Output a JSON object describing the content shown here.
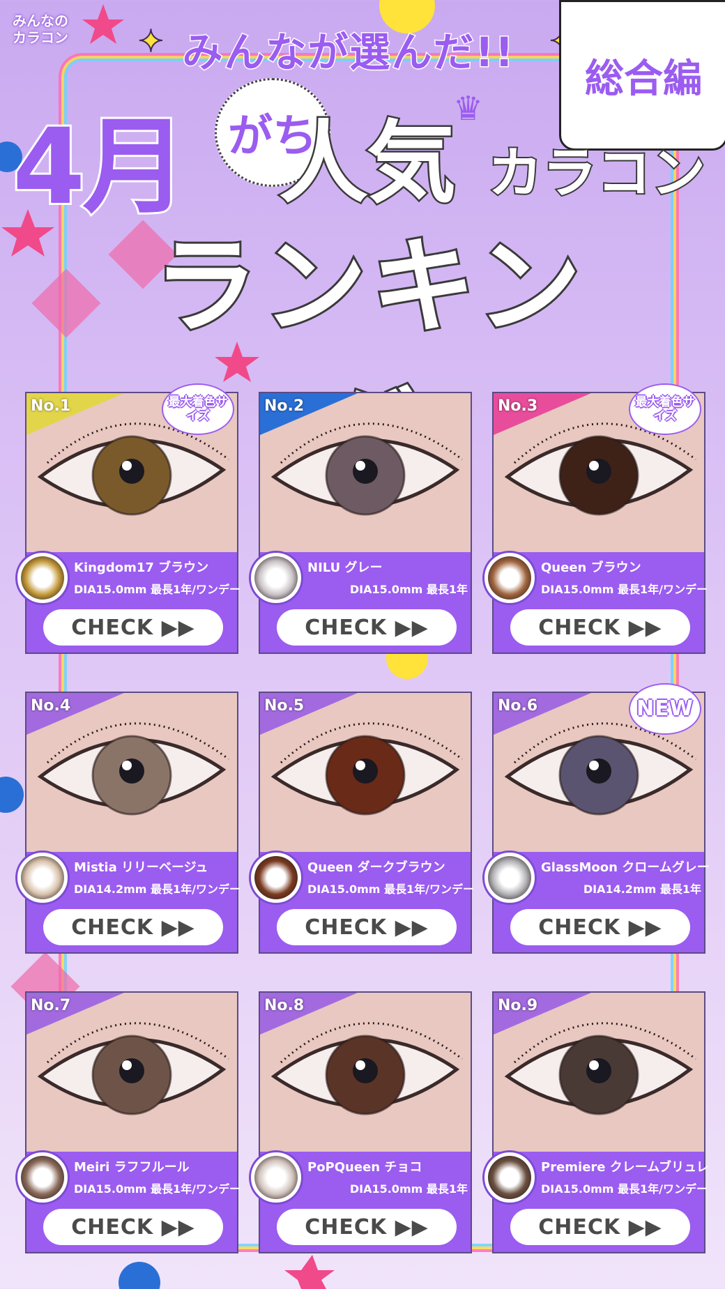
{
  "header": {
    "logo_line1": "みんなの",
    "logo_line2": "カラコン",
    "subtitle": "みんなが選んだ!!",
    "edition": "総合編",
    "month": "4月",
    "gachi": "がち",
    "popular": "人気",
    "karacon": "カラコン",
    "ranking": "ランキング",
    "sparkle_icon": "✦"
  },
  "colors": {
    "purple": "#9b5cf0",
    "rank1_tab": "#e3d54a",
    "rank2_tab": "#2a6fd6",
    "rank3_tab": "#e84d9c",
    "rank_other_tab": "#a36ae0"
  },
  "check_label": "CHECK ▶▶",
  "products": [
    {
      "rank": "No.1",
      "badge": "最大着色サイズ",
      "name": "Kingdom17  ブラウン",
      "spec": "DIA15.0mm  最長1年/ワンデー",
      "iris": "#7a5a2a",
      "lens": "#c49a3a"
    },
    {
      "rank": "No.2",
      "badge": "",
      "name": "NILU  グレー",
      "spec": "DIA15.0mm  最長1年",
      "iris": "#6d5a62",
      "lens": "#c9c2c6"
    },
    {
      "rank": "No.3",
      "badge": "最大着色サイズ",
      "name": "Queen  ブラウン",
      "spec": "DIA15.0mm  最長1年/ワンデー",
      "iris": "#3e2218",
      "lens": "#a0653f"
    },
    {
      "rank": "No.4",
      "badge": "",
      "name": "Mistia  リリーベージュ",
      "spec": "DIA14.2mm  最長1年/ワンデー",
      "iris": "#8a7468",
      "lens": "#d8c2ac"
    },
    {
      "rank": "No.5",
      "badge": "",
      "name": "Queen  ダークブラウン",
      "spec": "DIA15.0mm  最長1年/ワンデー",
      "iris": "#6a2a18",
      "lens": "#7a3a20"
    },
    {
      "rank": "No.6",
      "badge": "NEW",
      "name": "GlassMoon  クロームグレー",
      "spec": "DIA14.2mm  最長1年",
      "iris": "#5a5470",
      "lens": "#b4b4b8"
    },
    {
      "rank": "No.7",
      "badge": "",
      "name": "Meiri  ラフフルール",
      "spec": "DIA15.0mm  最長1年/ワンデー",
      "iris": "#6e5448",
      "lens": "#8a6a5a"
    },
    {
      "rank": "No.8",
      "badge": "",
      "name": "PoPQueen  チョコ",
      "spec": "DIA15.0mm  最長1年",
      "iris": "#5a3426",
      "lens": "#d2c4be"
    },
    {
      "rank": "No.9",
      "badge": "",
      "name": "Premiere  クレームブリュレ",
      "spec": "DIA15.0mm  最長1年/ワンデー",
      "iris": "#4a3a36",
      "lens": "#6a5040"
    }
  ]
}
